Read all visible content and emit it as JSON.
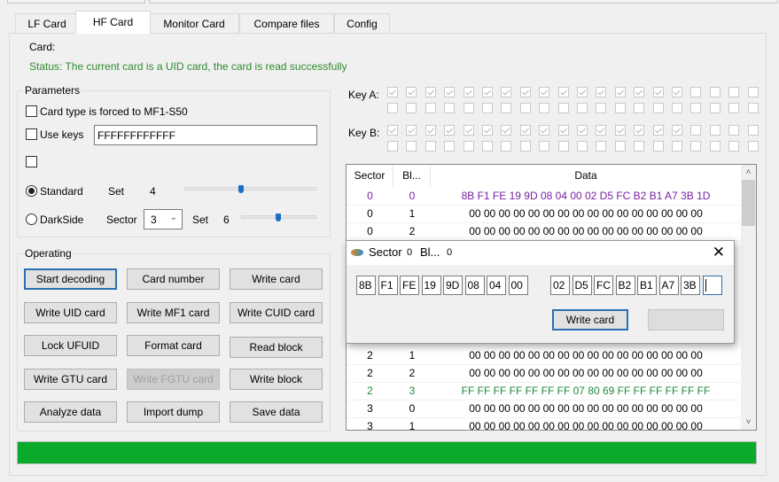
{
  "tabs": [
    {
      "label": "LF Card"
    },
    {
      "label": "HF Card",
      "active": true
    },
    {
      "label": "Monitor Card"
    },
    {
      "label": "Compare files"
    },
    {
      "label": "Config"
    }
  ],
  "card_label": "Card:",
  "status": "Status: The current card is a UID card, the card is read successfully",
  "status_color": "#2e8b2e",
  "parameters": {
    "title": "Parameters",
    "force_type": {
      "label": "Card type is forced to MF1-S50",
      "checked": false
    },
    "use_keys": {
      "label": "Use keys",
      "checked": false,
      "value": "FFFFFFFFFFFF"
    },
    "extra_checkbox": {
      "checked": false
    },
    "standard": {
      "label": "Standard",
      "selected": true,
      "set_label": "Set",
      "set_value": "4",
      "slider_level": 0.5
    },
    "darkside": {
      "label": "DarkSide",
      "selected": false,
      "sector_label": "Sector",
      "sector_value": "3",
      "set_label": "Set",
      "set_value": "6",
      "slider_level": 0.5
    }
  },
  "operating": {
    "title": "Operating",
    "buttons": [
      {
        "label": "Start decoding",
        "focused": true
      },
      {
        "label": "Card number"
      },
      {
        "label": "Write card"
      },
      {
        "label": "Write UID card"
      },
      {
        "label": "Write MF1 card"
      },
      {
        "label": "Write CUID card"
      },
      {
        "label": "Lock UFUID"
      },
      {
        "label": "Format card"
      },
      {
        "label": "Read block"
      },
      {
        "label": "Write GTU card"
      },
      {
        "label": "Write FGTU card",
        "disabled": true
      },
      {
        "label": "Write block"
      },
      {
        "label": "Analyze data"
      },
      {
        "label": "Import dump"
      },
      {
        "label": "Save data"
      }
    ]
  },
  "keys": {
    "key_a_label": "Key A:",
    "key_b_label": "Key B:",
    "sector_count": 20,
    "found_sectors": 16
  },
  "table": {
    "headers": [
      "Sector",
      "Bl...",
      "Data"
    ],
    "rows": [
      {
        "sector": "0",
        "block": "0",
        "data": "8B F1 FE 19 9D 08 04 00 02 D5 FC B2 B1 A7 3B 1D",
        "color": "#7a1fa2"
      },
      {
        "sector": "0",
        "block": "1",
        "data": "00 00 00 00 00 00 00 00 00 00 00 00 00 00 00 00"
      },
      {
        "sector": "0",
        "block": "2",
        "data": "00 00 00 00 00 00 00 00 00 00 00 00 00 00 00 00"
      },
      {
        "sector": "2",
        "block": "1",
        "data": "00 00 00 00 00 00 00 00 00 00 00 00 00 00 00 00"
      },
      {
        "sector": "2",
        "block": "2",
        "data": "00 00 00 00 00 00 00 00 00 00 00 00 00 00 00 00"
      },
      {
        "sector": "2",
        "block": "3",
        "data": "FF FF FF FF FF FF FF 07 80 69 FF FF FF FF FF FF",
        "color": "#1e8a3c"
      },
      {
        "sector": "3",
        "block": "0",
        "data": "00 00 00 00 00 00 00 00 00 00 00 00 00 00 00 00"
      },
      {
        "sector": "3",
        "block": "1",
        "data": "00 00 00 00 00 00 00 00 00 00 00 00 00 00 00 00"
      }
    ]
  },
  "dialog": {
    "sector_label": "Sector",
    "sector_value": "0",
    "block_label": "Bl...",
    "block_value": "0",
    "bytes": [
      "8B",
      "F1",
      "FE",
      "19",
      "9D",
      "08",
      "04",
      "00",
      "02",
      "D5",
      "FC",
      "B2",
      "B1",
      "A7",
      "3B",
      ""
    ],
    "write_label": "Write card",
    "second_button_label": ""
  },
  "progress": {
    "value": 100,
    "color": "#0aab2a"
  }
}
